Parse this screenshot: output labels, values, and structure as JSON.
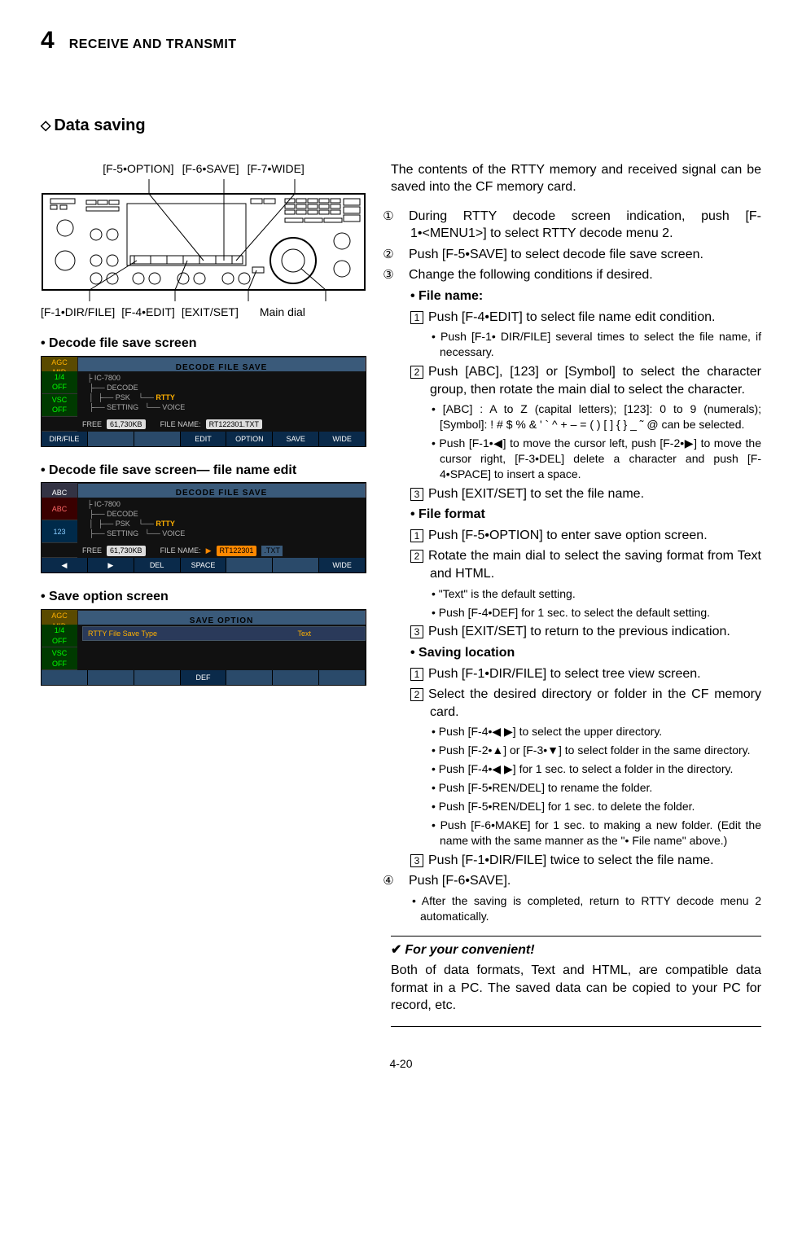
{
  "header": {
    "chapter": "4",
    "title": "RECEIVE AND TRANSMIT"
  },
  "section": {
    "diamond": "◇",
    "title": "Data saving"
  },
  "radio_diagram": {
    "top_labels": [
      "[F-5•OPTION]",
      "[F-6•SAVE]",
      "[F-7•WIDE]"
    ],
    "bottom_labels": [
      "[F-1•DIR/FILE]",
      "[F-4•EDIT]",
      "[EXIT/SET]",
      "Main dial"
    ]
  },
  "screens": {
    "s1": {
      "heading": "• Decode file save screen",
      "side": [
        "AGC",
        "MID",
        "1/4",
        "OFF",
        "VSC",
        "OFF"
      ],
      "title": "DECODE FILE SAVE",
      "tree": [
        "IC-7800",
        "DECODE",
        "PSK",
        "RTTY",
        "SETTING",
        "VOICE"
      ],
      "free_label": "FREE",
      "free_box": "61,730KB",
      "fname_label": "FILE NAME:",
      "fname_box": "RT122301.TXT",
      "foot": [
        "DIR/FILE",
        "",
        "",
        "EDIT",
        "OPTION",
        "SAVE",
        "WIDE"
      ]
    },
    "s2": {
      "heading": "• Decode file save screen— file name edit",
      "side": [
        "ABC",
        "ABC",
        "123"
      ],
      "title": "DECODE FILE SAVE",
      "tree": [
        "IC-7800",
        "DECODE",
        "PSK",
        "RTTY",
        "SETTING",
        "VOICE"
      ],
      "free_label": "FREE",
      "free_box": "61,730KB",
      "fname_label": "FILE NAME:",
      "fname_pre": "▶",
      "fname_mid": "RT122301",
      "fname_ext": ".TXT",
      "foot": [
        "◀",
        "▶",
        "DEL",
        "SPACE",
        "",
        "",
        "WIDE"
      ]
    },
    "s3": {
      "heading": "• Save option screen",
      "side": [
        "AGC",
        "MID",
        "1/4",
        "OFF",
        "VSC",
        "OFF"
      ],
      "title": "SAVE OPTION",
      "row_label": "RTTY File Save Type",
      "row_value": "Text",
      "foot": [
        "",
        "",
        "",
        "DEF",
        "",
        "",
        ""
      ]
    }
  },
  "body": {
    "intro": "The contents of the RTTY memory and received signal can be saved into the CF memory card.",
    "step1": {
      "mark": "①",
      "text": "During RTTY decode screen indication, push [F-1•<MENU1>] to select RTTY decode menu 2."
    },
    "step2": {
      "mark": "②",
      "text": "Push [F-5•SAVE] to select decode file save screen."
    },
    "step3": {
      "mark": "③",
      "text": "Change the following conditions if desired."
    },
    "filename_head": "• File name:",
    "fn1": {
      "n": "1",
      "text": "Push [F-4•EDIT] to select file name edit condition."
    },
    "fn1b": "• Push [F-1• DIR/FILE] several times to select the file name, if necessary.",
    "fn2": {
      "n": "2",
      "text": "Push [ABC], [123] or [Symbol] to select the character group, then rotate the main dial to select the character."
    },
    "fn2b1": "• [ABC] : A to Z (capital letters); [123]: 0 to 9 (numerals); [Symbol]: ! # $ % & ' ` ^ + – = ( ) [ ] { } _ ˜ @ can be selected.",
    "fn2b2": "• Push [F-1•◀] to move the cursor left, push [F-2•▶] to move the cursor right, [F-3•DEL] delete a character and push [F-4•SPACE] to insert a space.",
    "fn3": {
      "n": "3",
      "text": "Push [EXIT/SET] to set the file name."
    },
    "fileformat_head": "• File format",
    "ff1": {
      "n": "1",
      "text": "Push [F-5•OPTION] to enter save option screen."
    },
    "ff2": {
      "n": "2",
      "text": "Rotate the main dial to select the saving format from Text and HTML."
    },
    "ff2b1": "• \"Text\" is the default setting.",
    "ff2b2": "• Push [F-4•DEF] for 1 sec. to select the default setting.",
    "ff3": {
      "n": "3",
      "text": "Push [EXIT/SET] to return to the previous indication."
    },
    "saveloc_head": "• Saving location",
    "sl1": {
      "n": "1",
      "text": "Push [F-1•DIR/FILE] to select tree view screen."
    },
    "sl2": {
      "n": "2",
      "text": "Select the desired directory or folder in the CF memory card."
    },
    "sl2b1": "• Push [F-4•◀ ▶] to select the upper directory.",
    "sl2b2": "• Push [F-2•▲] or [F-3•▼] to select folder in the same directory.",
    "sl2b3": "• Push [F-4•◀ ▶] for 1 sec. to select a folder in the directory.",
    "sl2b4": "• Push [F-5•REN/DEL] to rename the folder.",
    "sl2b5": "• Push [F-5•REN/DEL] for 1 sec. to delete the folder.",
    "sl2b6": "• Push [F-6•MAKE] for 1 sec. to making a new folder. (Edit the name with the same manner as the \"• File name\" above.)",
    "sl3": {
      "n": "3",
      "text": "Push [F-1•DIR/FILE] twice to select the file name."
    },
    "step4": {
      "mark": "④",
      "text": "Push [F-6•SAVE]."
    },
    "step4b": "• After the saving is completed, return to RTTY decode menu 2 automatically.",
    "tip_head": "For your convenient!",
    "tip_check": "✔",
    "tip_body": "Both of data formats, Text and HTML, are compatible data format in a PC. The saved data can be copied to your PC for record, etc."
  },
  "footer_page": "4-20"
}
